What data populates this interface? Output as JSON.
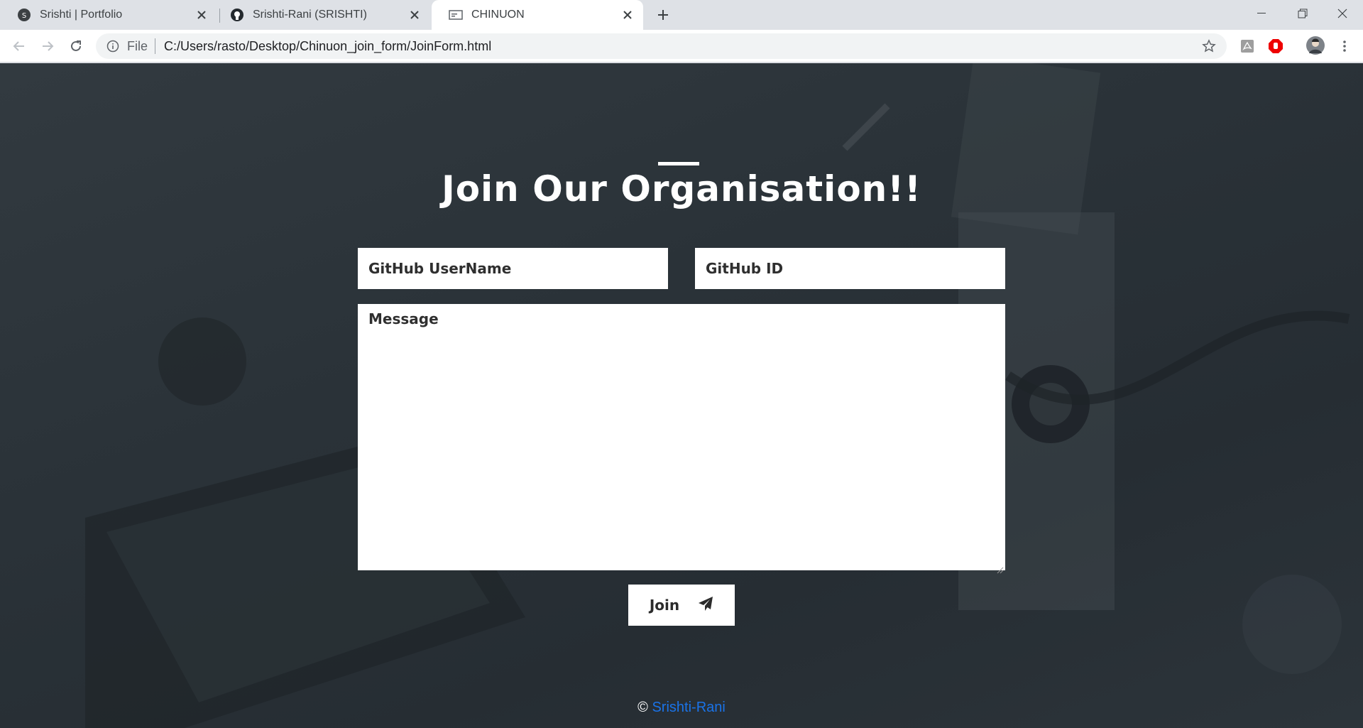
{
  "browser": {
    "tabs": [
      {
        "label": "Srishti | Portfolio",
        "icon": "portfolio-favicon-icon",
        "active": false
      },
      {
        "label": "Srishti-Rani (SRISHTI)",
        "icon": "github-icon",
        "active": false
      },
      {
        "label": "CHINUON",
        "icon": "page-favicon-icon",
        "active": true
      }
    ],
    "address": {
      "scheme_label": "File",
      "url": "C:/Users/rasto/Desktop/Chinuon_join_form/JoinForm.html"
    }
  },
  "page": {
    "title": "Join Our Organisation!!",
    "form": {
      "username_placeholder": "GitHub UserName",
      "id_placeholder": "GitHub ID",
      "message_placeholder": "Message",
      "submit_label": "Join"
    },
    "footer": {
      "copyright_symbol": "©",
      "link_text": "Srishti-Rani"
    }
  },
  "colors": {
    "link": "#1a73e8",
    "background": "#2a3238",
    "field": "#ffffff"
  }
}
